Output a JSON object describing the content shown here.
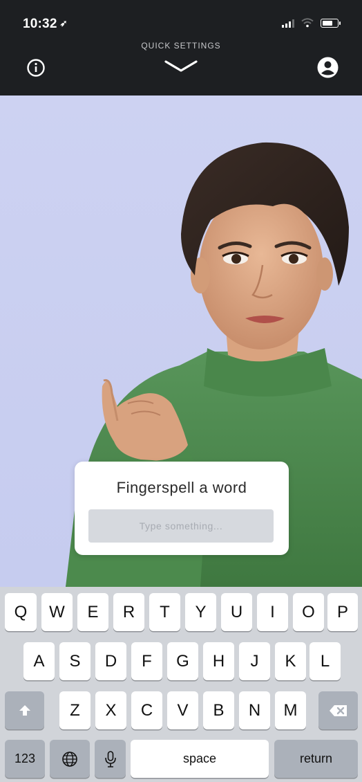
{
  "status_bar": {
    "time": "10:32",
    "location_arrow": "➶"
  },
  "header": {
    "quick_settings_label": "QUICK SETTINGS",
    "icons": {
      "info": "info-icon",
      "collapse": "chevron-down-icon",
      "profile": "account-circle-icon"
    }
  },
  "fingerspell": {
    "title": "Fingerspell a word",
    "placeholder": "Type something..."
  },
  "keyboard": {
    "row1": [
      "Q",
      "W",
      "E",
      "R",
      "T",
      "Y",
      "U",
      "I",
      "O",
      "P"
    ],
    "row2": [
      "A",
      "S",
      "D",
      "F",
      "G",
      "H",
      "J",
      "K",
      "L"
    ],
    "row3": [
      "Z",
      "X",
      "C",
      "V",
      "B",
      "N",
      "M"
    ],
    "numbers_label": "123",
    "space_label": "space",
    "return_label": "return",
    "icons": {
      "shift": "shift-icon",
      "backspace": "backspace-icon",
      "globe": "globe-icon",
      "mic": "microphone-icon"
    }
  },
  "colors": {
    "header_bg": "#1d1f22",
    "stage_bg": "#c9cff0",
    "sweater": "#4f8a4c",
    "keyboard_bg": "#d1d4d9"
  }
}
